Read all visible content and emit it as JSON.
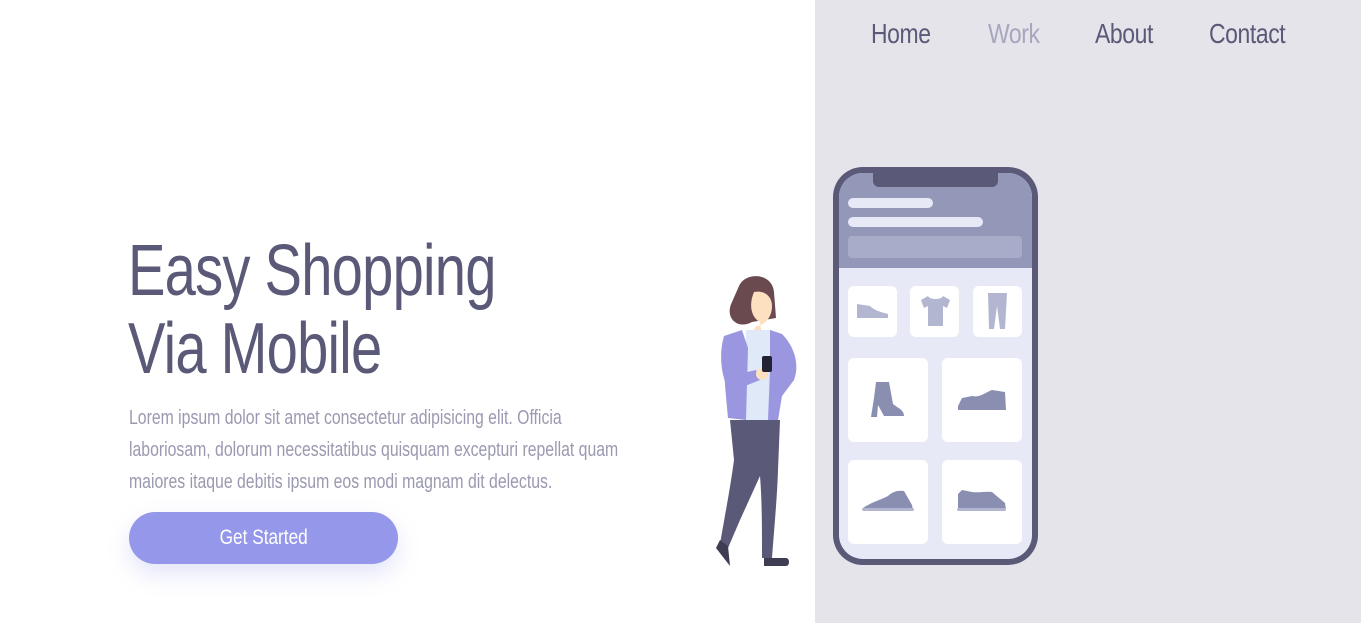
{
  "nav": {
    "items": [
      {
        "label": "Home",
        "active": false
      },
      {
        "label": "Work",
        "active": true
      },
      {
        "label": "About",
        "active": false
      },
      {
        "label": "Contact",
        "active": false
      }
    ]
  },
  "hero": {
    "title_line1": "Easy Shopping",
    "title_line2": "Via Mobile",
    "description": "Lorem ipsum dolor sit amet consectetur adipisicing elit. Officia laboriosam, dolorum necessitatibus quisquam excepturi repellat quam maiores itaque debitis ipsum eos modi magnam dit delectus.",
    "cta_label": "Get Started"
  },
  "colors": {
    "primary_text": "#5a5978",
    "muted_text": "#9a99b0",
    "accent": "#9598ea",
    "panel_bg": "#e5e4ea"
  },
  "illustration": {
    "icons": [
      "shoe-icon",
      "tshirt-icon",
      "pants-icon",
      "boot-icon",
      "sneaker-icon",
      "sneaker-icon",
      "sneaker-icon"
    ]
  }
}
